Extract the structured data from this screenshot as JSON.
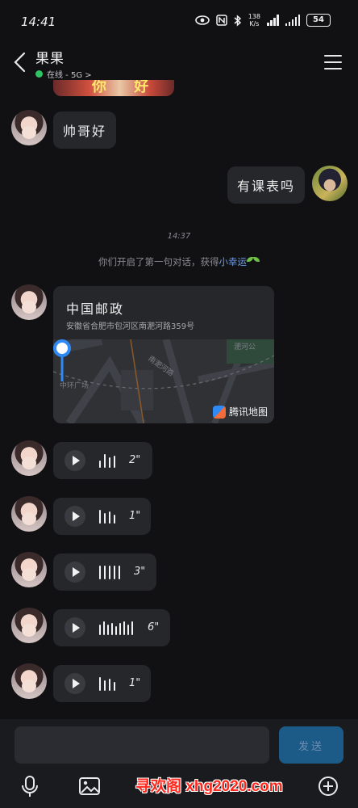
{
  "status_bar": {
    "time": "14:41",
    "net_speed_value": "138",
    "net_speed_unit": "K/s",
    "battery": "54"
  },
  "header": {
    "contact_name": "果果",
    "online_status": "在线 - 5G >"
  },
  "partial_image_text": "你 好",
  "messages": {
    "peer_text_1": "帅哥好",
    "my_text_1": "有课表吗",
    "timestamp": "14:37",
    "system_notice_prefix": "你们开启了第一句对话，获得",
    "system_notice_link": "小幸运"
  },
  "location_card": {
    "title": "中国邮政",
    "address": "安徽省合肥市包河区南淝河路359号",
    "road_label_1": "南淝河路",
    "road_label_2": "中环广场",
    "road_label_3": "淝河公",
    "map_provider": "腾讯地图"
  },
  "voice_messages": [
    {
      "duration": "2\""
    },
    {
      "duration": "1\""
    },
    {
      "duration": "3\""
    },
    {
      "duration": "6\""
    },
    {
      "duration": "1\""
    }
  ],
  "input_bar": {
    "placeholder": "",
    "send_label": "发送"
  },
  "watermark": "寻欢阁 xhg2020.com",
  "colors": {
    "background": "#111114",
    "bubble": "#26272b",
    "online": "#2fc463",
    "send_button": "#1c5a88",
    "link": "#6f9fe8"
  },
  "icons": [
    "back-icon",
    "menu-icon",
    "play-icon",
    "mic-icon",
    "image-icon",
    "plus-icon"
  ]
}
